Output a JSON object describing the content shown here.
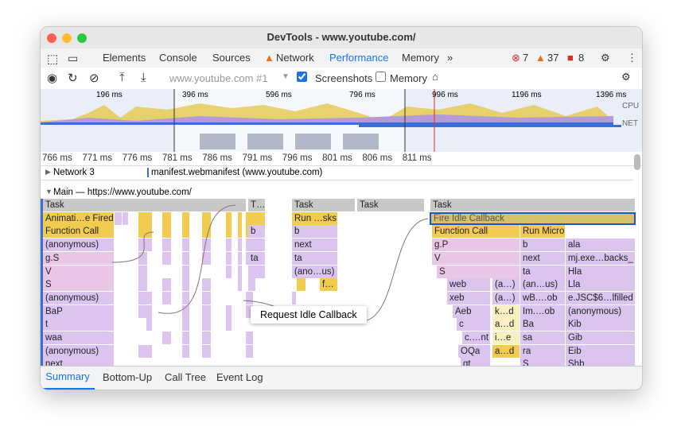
{
  "window": {
    "title": "DevTools - www.youtube.com/"
  },
  "tabs": [
    "Elements",
    "Console",
    "Sources",
    "Network",
    "Performance",
    "Memory"
  ],
  "active_tab": "Performance",
  "badges": {
    "errors": "7",
    "warnings": "37",
    "issues": "8"
  },
  "toolbar": {
    "url_select": "www.youtube.com #1",
    "screenshots_label": "Screenshots",
    "screenshots_checked": true,
    "memory_label": "Memory",
    "memory_checked": false
  },
  "overview": {
    "ticks": [
      "196 ms",
      "396 ms",
      "596 ms",
      "796 ms",
      "996 ms",
      "1196 ms",
      "1396 ms"
    ],
    "cpu_label": "CPU",
    "net_label": "NET"
  },
  "ruler": [
    "766 ms",
    "771 ms",
    "776 ms",
    "781 ms",
    "786 ms",
    "791 ms",
    "796 ms",
    "801 ms",
    "806 ms",
    "811 ms"
  ],
  "network_track": {
    "label": "Network 3",
    "request": "manifest.webmanifest (www.youtube.com)"
  },
  "main_track": {
    "label": "Main — https://www.youtube.com/"
  },
  "flame": {
    "left": [
      "Task",
      "Animati…e Fired",
      "Function Call",
      "(anonymous)",
      "g.S",
      "V",
      "S",
      "(anonymous)",
      "BaP",
      "t",
      "waa",
      "(anonymous)",
      "next"
    ],
    "mid1": [
      "T…",
      "b",
      "ta"
    ],
    "mid2": [
      "Task",
      "Run …sks",
      "b",
      "next",
      "ta",
      "(ano…us)",
      "f…"
    ],
    "mid3": [
      "Task"
    ],
    "right_task": "Task",
    "selected": "Fire Idle Callback",
    "right_a": [
      "Function Call",
      "g.P",
      "V",
      "S",
      "web",
      "xeb",
      "Aeb",
      "c",
      "c.…nt",
      "OQa",
      "gt"
    ],
    "right_a2": [
      "(a…)",
      "(a…)",
      "k…d",
      "a…d",
      "i…e",
      "a…d"
    ],
    "right_b": [
      "Run Microtasks",
      "b",
      "next",
      "ta",
      "(an…us)",
      "wB.…ob",
      "Im.…ob",
      "Ba",
      "sa",
      "ra",
      "S"
    ],
    "right_c": [
      "ala",
      "mj.exe…backs_",
      "Hla",
      "Lla",
      "e.JSC$6…lfilled",
      "(anonymous)",
      "Kib",
      "Gib",
      "Eib",
      "Shb"
    ]
  },
  "tooltip": "Request Idle Callback",
  "bottom_tabs": [
    "Summary",
    "Bottom-Up",
    "Call Tree",
    "Event Log"
  ],
  "active_bottom_tab": "Summary",
  "colors": {
    "accent": "#1a73e8",
    "task": "#c8c8c8",
    "yellow": "#f2cc4f",
    "purple": "#dcc4f0",
    "pink": "#eac6e6",
    "selected": "#d6c06a"
  }
}
